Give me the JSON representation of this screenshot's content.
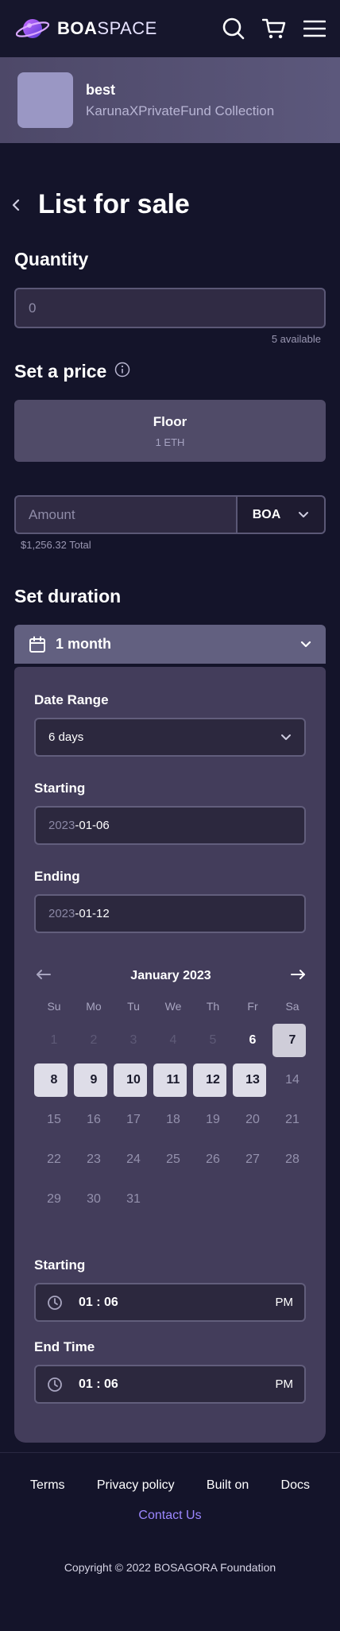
{
  "header": {
    "logo_bold": "BOA",
    "logo_light": "SPACE",
    "icons": [
      "search-icon",
      "cart-icon",
      "menu-icon"
    ]
  },
  "collection": {
    "name": "best",
    "subtitle": "KarunaXPrivateFund Collection"
  },
  "page": {
    "title": "List for sale"
  },
  "quantity": {
    "label": "Quantity",
    "value": "0",
    "available": "5 available"
  },
  "price": {
    "label": "Set a price",
    "floor_title": "Floor",
    "floor_value": "1 ETH",
    "amount_placeholder": "Amount",
    "currency": "BOA",
    "total": "$1,256.32 Total"
  },
  "duration": {
    "label": "Set duration",
    "selected": "1 month",
    "date_range_label": "Date Range",
    "date_range_value": "6 days",
    "starting_label": "Starting",
    "starting_year": "2023",
    "starting_rest": "-01-06",
    "ending_label": "Ending",
    "ending_year": "2023",
    "ending_rest": "-01-12"
  },
  "calendar": {
    "month": "January 2023",
    "weekdays": [
      "Su",
      "Mo",
      "Tu",
      "We",
      "Th",
      "Fr",
      "Sa"
    ],
    "days": [
      {
        "d": "1",
        "s": "past"
      },
      {
        "d": "2",
        "s": "past"
      },
      {
        "d": "3",
        "s": "past"
      },
      {
        "d": "4",
        "s": "past"
      },
      {
        "d": "5",
        "s": "past"
      },
      {
        "d": "6",
        "s": "today"
      },
      {
        "d": "7",
        "s": "end"
      },
      {
        "d": "8",
        "s": "sel"
      },
      {
        "d": "9",
        "s": "sel"
      },
      {
        "d": "10",
        "s": "sel"
      },
      {
        "d": "11",
        "s": "sel"
      },
      {
        "d": "12",
        "s": "sel"
      },
      {
        "d": "13",
        "s": "sel"
      },
      {
        "d": "14",
        "s": ""
      },
      {
        "d": "15",
        "s": ""
      },
      {
        "d": "16",
        "s": ""
      },
      {
        "d": "17",
        "s": ""
      },
      {
        "d": "18",
        "s": ""
      },
      {
        "d": "19",
        "s": ""
      },
      {
        "d": "20",
        "s": ""
      },
      {
        "d": "21",
        "s": ""
      },
      {
        "d": "22",
        "s": ""
      },
      {
        "d": "23",
        "s": ""
      },
      {
        "d": "24",
        "s": ""
      },
      {
        "d": "25",
        "s": ""
      },
      {
        "d": "26",
        "s": ""
      },
      {
        "d": "27",
        "s": ""
      },
      {
        "d": "28",
        "s": ""
      },
      {
        "d": "29",
        "s": ""
      },
      {
        "d": "30",
        "s": ""
      },
      {
        "d": "31",
        "s": ""
      }
    ]
  },
  "times": {
    "start_label": "Starting",
    "start_value": "01 : 06",
    "start_ampm": "PM",
    "end_label": "End Time",
    "end_value": "01 : 06",
    "end_ampm": "PM"
  },
  "footer": {
    "links": [
      "Terms",
      "Privacy policy",
      "Built on",
      "Docs"
    ],
    "contact": "Contact Us",
    "copyright": "Copyright © 2022 BOSAGORA Foundation"
  },
  "colors": {
    "background": "#14142a",
    "panel": "#433d5b",
    "accent": "#9c87ff"
  }
}
